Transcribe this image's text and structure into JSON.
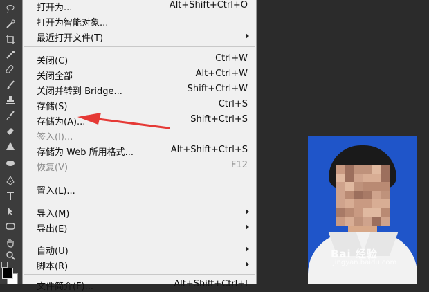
{
  "menu": {
    "items": [
      {
        "label": "打开为...",
        "shortcut": "Alt+Shift+Ctrl+O"
      },
      {
        "label": "打开为智能对象...",
        "shortcut": ""
      },
      {
        "label": "最近打开文件(T)",
        "shortcut": "",
        "submenu": true
      },
      {
        "label": "关闭(C)",
        "shortcut": "Ctrl+W"
      },
      {
        "label": "关闭全部",
        "shortcut": "Alt+Ctrl+W"
      },
      {
        "label": "关闭并转到 Bridge...",
        "shortcut": "Shift+Ctrl+W"
      },
      {
        "label": "存储(S)",
        "shortcut": "Ctrl+S"
      },
      {
        "label": "存储为(A)...",
        "shortcut": "Shift+Ctrl+S"
      },
      {
        "label": "签入(I)...",
        "shortcut": "",
        "disabled": true
      },
      {
        "label": "存储为 Web 所用格式...",
        "shortcut": "Alt+Shift+Ctrl+S"
      },
      {
        "label": "恢复(V)",
        "shortcut": "F12",
        "disabled": true
      },
      {
        "label": "置入(L)...",
        "shortcut": ""
      },
      {
        "label": "导入(M)",
        "shortcut": "",
        "submenu": true
      },
      {
        "label": "导出(E)",
        "shortcut": "",
        "submenu": true
      },
      {
        "label": "自动(U)",
        "shortcut": "",
        "submenu": true
      },
      {
        "label": "脚本(R)",
        "shortcut": "",
        "submenu": true
      },
      {
        "label": "文件简介(F)...",
        "shortcut": "Alt+Shift+Ctrl+I"
      }
    ]
  },
  "watermark": {
    "text": "Bai 经验",
    "sub": "jingyan.baidu.com"
  },
  "colors": {
    "arrow": "#e53935",
    "photo_bg": "#1f55c9",
    "menu_bg": "#f0f0f0",
    "workspace": "#2b2b2b"
  }
}
